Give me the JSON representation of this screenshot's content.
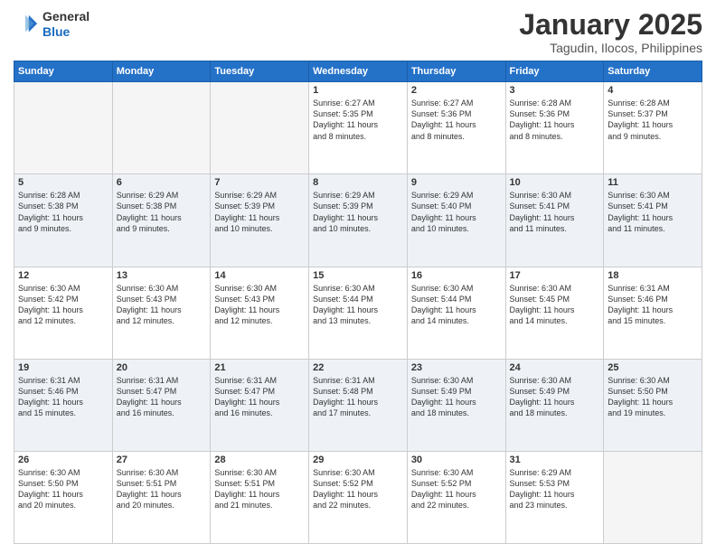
{
  "logo": {
    "line1": "General",
    "line2": "Blue"
  },
  "title": "January 2025",
  "subtitle": "Tagudin, Ilocos, Philippines",
  "headers": [
    "Sunday",
    "Monday",
    "Tuesday",
    "Wednesday",
    "Thursday",
    "Friday",
    "Saturday"
  ],
  "weeks": [
    {
      "shade": "white",
      "days": [
        {
          "num": "",
          "info": ""
        },
        {
          "num": "",
          "info": ""
        },
        {
          "num": "",
          "info": ""
        },
        {
          "num": "1",
          "info": "Sunrise: 6:27 AM\nSunset: 5:35 PM\nDaylight: 11 hours\nand 8 minutes."
        },
        {
          "num": "2",
          "info": "Sunrise: 6:27 AM\nSunset: 5:36 PM\nDaylight: 11 hours\nand 8 minutes."
        },
        {
          "num": "3",
          "info": "Sunrise: 6:28 AM\nSunset: 5:36 PM\nDaylight: 11 hours\nand 8 minutes."
        },
        {
          "num": "4",
          "info": "Sunrise: 6:28 AM\nSunset: 5:37 PM\nDaylight: 11 hours\nand 9 minutes."
        }
      ]
    },
    {
      "shade": "shade",
      "days": [
        {
          "num": "5",
          "info": "Sunrise: 6:28 AM\nSunset: 5:38 PM\nDaylight: 11 hours\nand 9 minutes."
        },
        {
          "num": "6",
          "info": "Sunrise: 6:29 AM\nSunset: 5:38 PM\nDaylight: 11 hours\nand 9 minutes."
        },
        {
          "num": "7",
          "info": "Sunrise: 6:29 AM\nSunset: 5:39 PM\nDaylight: 11 hours\nand 10 minutes."
        },
        {
          "num": "8",
          "info": "Sunrise: 6:29 AM\nSunset: 5:39 PM\nDaylight: 11 hours\nand 10 minutes."
        },
        {
          "num": "9",
          "info": "Sunrise: 6:29 AM\nSunset: 5:40 PM\nDaylight: 11 hours\nand 10 minutes."
        },
        {
          "num": "10",
          "info": "Sunrise: 6:30 AM\nSunset: 5:41 PM\nDaylight: 11 hours\nand 11 minutes."
        },
        {
          "num": "11",
          "info": "Sunrise: 6:30 AM\nSunset: 5:41 PM\nDaylight: 11 hours\nand 11 minutes."
        }
      ]
    },
    {
      "shade": "white",
      "days": [
        {
          "num": "12",
          "info": "Sunrise: 6:30 AM\nSunset: 5:42 PM\nDaylight: 11 hours\nand 12 minutes."
        },
        {
          "num": "13",
          "info": "Sunrise: 6:30 AM\nSunset: 5:43 PM\nDaylight: 11 hours\nand 12 minutes."
        },
        {
          "num": "14",
          "info": "Sunrise: 6:30 AM\nSunset: 5:43 PM\nDaylight: 11 hours\nand 12 minutes."
        },
        {
          "num": "15",
          "info": "Sunrise: 6:30 AM\nSunset: 5:44 PM\nDaylight: 11 hours\nand 13 minutes."
        },
        {
          "num": "16",
          "info": "Sunrise: 6:30 AM\nSunset: 5:44 PM\nDaylight: 11 hours\nand 14 minutes."
        },
        {
          "num": "17",
          "info": "Sunrise: 6:30 AM\nSunset: 5:45 PM\nDaylight: 11 hours\nand 14 minutes."
        },
        {
          "num": "18",
          "info": "Sunrise: 6:31 AM\nSunset: 5:46 PM\nDaylight: 11 hours\nand 15 minutes."
        }
      ]
    },
    {
      "shade": "shade",
      "days": [
        {
          "num": "19",
          "info": "Sunrise: 6:31 AM\nSunset: 5:46 PM\nDaylight: 11 hours\nand 15 minutes."
        },
        {
          "num": "20",
          "info": "Sunrise: 6:31 AM\nSunset: 5:47 PM\nDaylight: 11 hours\nand 16 minutes."
        },
        {
          "num": "21",
          "info": "Sunrise: 6:31 AM\nSunset: 5:47 PM\nDaylight: 11 hours\nand 16 minutes."
        },
        {
          "num": "22",
          "info": "Sunrise: 6:31 AM\nSunset: 5:48 PM\nDaylight: 11 hours\nand 17 minutes."
        },
        {
          "num": "23",
          "info": "Sunrise: 6:30 AM\nSunset: 5:49 PM\nDaylight: 11 hours\nand 18 minutes."
        },
        {
          "num": "24",
          "info": "Sunrise: 6:30 AM\nSunset: 5:49 PM\nDaylight: 11 hours\nand 18 minutes."
        },
        {
          "num": "25",
          "info": "Sunrise: 6:30 AM\nSunset: 5:50 PM\nDaylight: 11 hours\nand 19 minutes."
        }
      ]
    },
    {
      "shade": "white",
      "days": [
        {
          "num": "26",
          "info": "Sunrise: 6:30 AM\nSunset: 5:50 PM\nDaylight: 11 hours\nand 20 minutes."
        },
        {
          "num": "27",
          "info": "Sunrise: 6:30 AM\nSunset: 5:51 PM\nDaylight: 11 hours\nand 20 minutes."
        },
        {
          "num": "28",
          "info": "Sunrise: 6:30 AM\nSunset: 5:51 PM\nDaylight: 11 hours\nand 21 minutes."
        },
        {
          "num": "29",
          "info": "Sunrise: 6:30 AM\nSunset: 5:52 PM\nDaylight: 11 hours\nand 22 minutes."
        },
        {
          "num": "30",
          "info": "Sunrise: 6:30 AM\nSunset: 5:52 PM\nDaylight: 11 hours\nand 22 minutes."
        },
        {
          "num": "31",
          "info": "Sunrise: 6:29 AM\nSunset: 5:53 PM\nDaylight: 11 hours\nand 23 minutes."
        },
        {
          "num": "",
          "info": ""
        }
      ]
    }
  ]
}
